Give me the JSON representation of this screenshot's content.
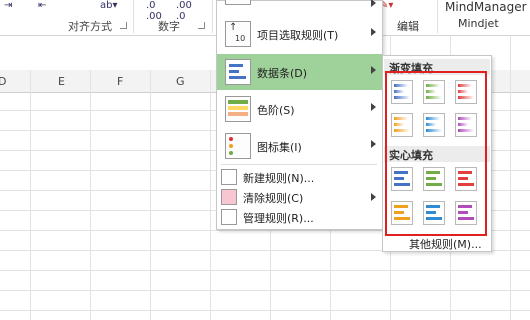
{
  "ribbon": {
    "align_group": "对齐方式",
    "number_group": "数字",
    "edit_group": "编辑",
    "mindmanager_title": "MindManager",
    "mindjet_label": "Mindjet"
  },
  "columns": [
    "D",
    "E",
    "F",
    "G"
  ],
  "menu": {
    "items": [
      {
        "label": "项目选取规则(T)",
        "icon": "top-bottom-rules-icon"
      },
      {
        "label": "数据条(D)",
        "icon": "data-bars-icon"
      },
      {
        "label": "色阶(S)",
        "icon": "color-scales-icon"
      },
      {
        "label": "图标集(I)",
        "icon": "icon-sets-icon"
      }
    ],
    "small_items": [
      {
        "label": "新建规则(N)...",
        "icon": "new-rule-icon"
      },
      {
        "label": "清除规则(C)",
        "icon": "clear-rules-icon"
      },
      {
        "label": "管理规则(R)...",
        "icon": "manage-rules-icon"
      }
    ]
  },
  "submenu": {
    "gradient_header": "渐变填充",
    "solid_header": "实心填充",
    "more": "其他规则(M)...",
    "colors": [
      "#4472c4",
      "#70ad47",
      "#e04040",
      "#f0a020",
      "#2e8bd6",
      "#b04dbb"
    ]
  }
}
